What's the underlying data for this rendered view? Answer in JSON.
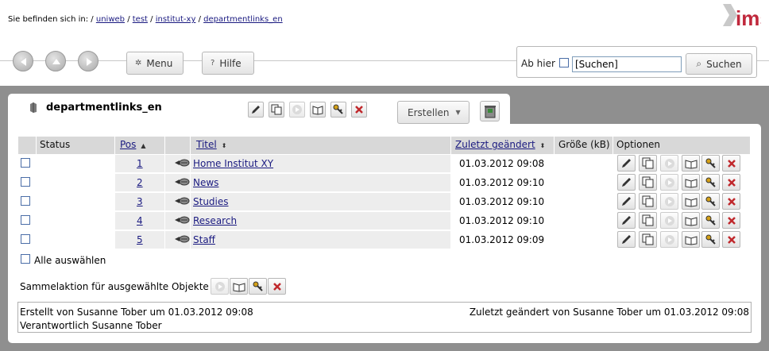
{
  "location": {
    "prefix": "Sie befinden sich in:",
    "crumbs": [
      "uniweb",
      "test",
      "institut-xy",
      "departmentlinks_en"
    ],
    "separator": "/"
  },
  "brand": {
    "logo_text": "ims"
  },
  "nav": {
    "menu_label": "Menu",
    "help_label": "Hilfe",
    "from_here_label": "Ab hier",
    "search_value": "[Suchen]",
    "search_button_label": "Suchen"
  },
  "object": {
    "title": "departmentlinks_en",
    "create_label": "Erstellen"
  },
  "table": {
    "headers": {
      "status": "Status",
      "pos": "Pos",
      "title": "Titel",
      "modified": "Zuletzt geändert",
      "size": "Größe (kB)",
      "options": "Optionen"
    },
    "rows": [
      {
        "pos": "1",
        "title": "Home Institut XY",
        "modified": "01.03.2012 09:08"
      },
      {
        "pos": "2",
        "title": "News",
        "modified": "01.03.2012 09:10"
      },
      {
        "pos": "3",
        "title": "Studies",
        "modified": "01.03.2012 09:10"
      },
      {
        "pos": "4",
        "title": "Research",
        "modified": "01.03.2012 09:10"
      },
      {
        "pos": "5",
        "title": "Staff",
        "modified": "01.03.2012 09:09"
      }
    ],
    "select_all_label": "Alle auswählen",
    "bulk_action_label": "Sammelaktion für ausgewählte Objekte"
  },
  "footer": {
    "created": "Erstellt von Susanne Tober um 01.03.2012 09:08",
    "responsible": "Verantwortlich Susanne Tober",
    "modified": "Zuletzt geändert von Susanne Tober um 01.03.2012 09:08"
  },
  "colors": {
    "link": "#1a1a80",
    "workspace": "#8f8f8f",
    "header_bg": "#d8d8d8",
    "logo_red": "#c0283c",
    "delete_red": "#c0282c"
  }
}
